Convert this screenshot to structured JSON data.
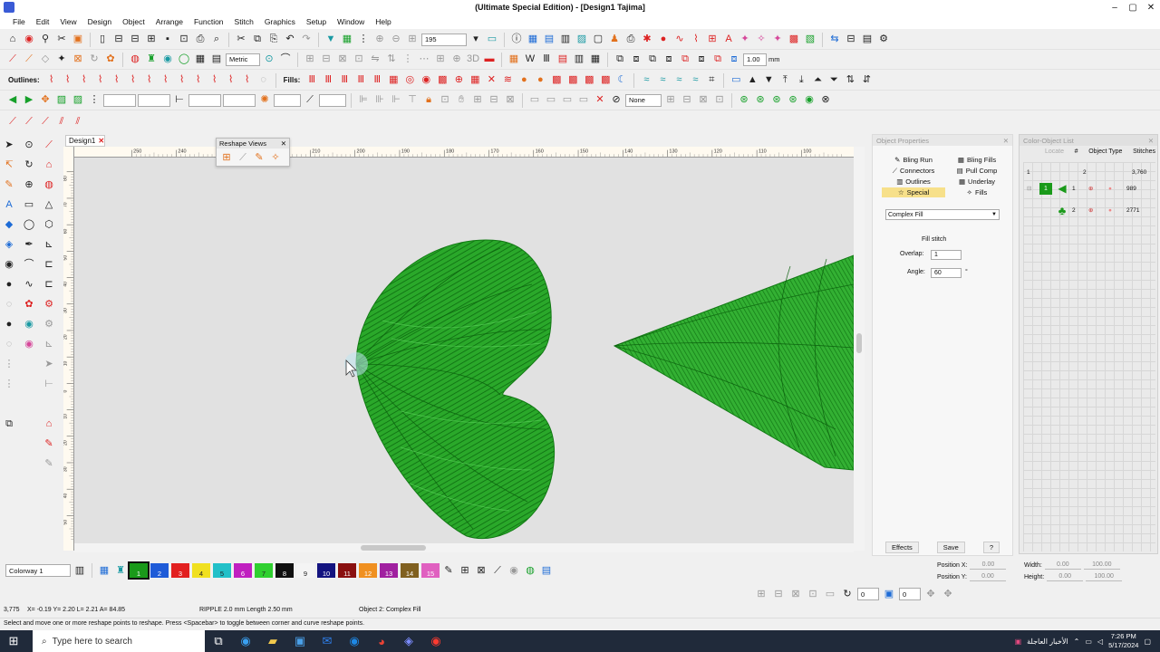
{
  "window": {
    "title": "(Ultimate Special Edition) - [Design1     Tajima]",
    "controls": [
      "–",
      "▢",
      "✕"
    ]
  },
  "menu": [
    "File",
    "Edit",
    "View",
    "Design",
    "Object",
    "Arrange",
    "Function",
    "Stitch",
    "Graphics",
    "Setup",
    "Window",
    "Help"
  ],
  "toolbar1": {
    "zoom_value": "195",
    "icons_left": [
      "home-icon",
      "open-book-icon",
      "pin-icon",
      "needle-icon",
      "folder-icon",
      "new-icon",
      "open-icon",
      "open2-icon",
      "open3-icon",
      "save-icon",
      "print-icon",
      "print-preview-icon",
      "cut-icon",
      "copy-icon",
      "paste-icon",
      "undo-icon",
      "redo-icon",
      "stitch-player-icon",
      "stitch-view-icon",
      "stitch-icon",
      "zoom-icon",
      "zoom-box-icon",
      "pan-icon"
    ],
    "icons_right": [
      "info-icon",
      "grid-icon",
      "tile-icon",
      "page-icon",
      "frame-icon",
      "hoop-icon",
      "user-icon",
      "print2-icon",
      "red-dot-icon",
      "curve-icon",
      "path-icon",
      "text-icon",
      "shape-icon",
      "shape2-icon",
      "shape3-icon",
      "fill-icon",
      "crosshatch-icon",
      "transfer-icon",
      "export-icon",
      "trace-icon",
      "gear-icon"
    ]
  },
  "toolbar2": {
    "units_value": "Metric",
    "size_value": "1.00",
    "size_unit": "mm"
  },
  "toolbar3": {
    "outlines_label": "Outlines:",
    "fills_label": "Fills:"
  },
  "toolbar4": {
    "none_value": "None"
  },
  "document": {
    "tab_label": "Design1"
  },
  "rulers": {
    "h_ticks": [
      "250",
      "240",
      "230",
      "220",
      "210",
      "200",
      "190",
      "180",
      "170",
      "160",
      "150",
      "140",
      "130",
      "120",
      "110",
      "100"
    ],
    "v_ticks": [
      "80",
      "70",
      "60",
      "50",
      "40",
      "30",
      "20",
      "10",
      "0",
      "10",
      "20",
      "30",
      "40",
      "50"
    ]
  },
  "reshape_views": {
    "title": "Reshape Views"
  },
  "object_properties": {
    "title": "Object Properties",
    "tabs": [
      {
        "label": "Bling Run",
        "active": false
      },
      {
        "label": "Bling Fills",
        "active": false
      },
      {
        "label": "Connectors",
        "active": false
      },
      {
        "label": "Pull Comp",
        "active": false
      },
      {
        "label": "Outlines",
        "active": false
      },
      {
        "label": "Underlay",
        "active": false
      },
      {
        "label": "Special",
        "active": true
      },
      {
        "label": "Fills",
        "active": false
      }
    ],
    "fill_type": "Complex Fill",
    "section_label": "Fill stitch",
    "overlap_label": "Overlap:",
    "overlap_value": "1",
    "angle_label": "Angle:",
    "angle_value": "60",
    "angle_unit": "°",
    "effects_button": "Effects",
    "save_button": "Save",
    "help_button": "?"
  },
  "color_list": {
    "title": "Color-Object List",
    "locate": "Locate",
    "col_number": "#",
    "col_type": "Object Type",
    "col_stitches": "Stitches",
    "total_index": "1",
    "total_count": "2",
    "total_stitches": "3,760",
    "rows": [
      {
        "index": "1",
        "stitches": "989"
      },
      {
        "index": "2",
        "stitches": "2771"
      }
    ]
  },
  "colorbar": {
    "colorway": "Colorway 1",
    "swatches": [
      {
        "num": "1",
        "color": "#1a9a1a"
      },
      {
        "num": "2",
        "color": "#1e5bd8"
      },
      {
        "num": "3",
        "color": "#e22020"
      },
      {
        "num": "4",
        "color": "#f0e020"
      },
      {
        "num": "5",
        "color": "#22c0c8"
      },
      {
        "num": "6",
        "color": "#c020c0"
      },
      {
        "num": "7",
        "color": "#30d030"
      },
      {
        "num": "8",
        "color": "#101010"
      },
      {
        "num": "9",
        "color": "#f4f4f4"
      },
      {
        "num": "10",
        "color": "#141480"
      },
      {
        "num": "11",
        "color": "#8a1010"
      },
      {
        "num": "12",
        "color": "#f09020"
      },
      {
        "num": "13",
        "color": "#a020a0"
      },
      {
        "num": "14",
        "color": "#806020"
      },
      {
        "num": "15",
        "color": "#e060c0"
      }
    ]
  },
  "position": {
    "pos_x_label": "Position X:",
    "pos_x": "0.00",
    "pos_y_label": "Position Y:",
    "pos_y": "0.00",
    "width_label": "Width:",
    "width": "0.00",
    "height_label": "Height:",
    "height": "0.00",
    "scale_w": "100.00",
    "scale_h": "100.00"
  },
  "zoombar": {
    "val1": "0",
    "val2": "0"
  },
  "status": {
    "stitch_count": "3,775",
    "coords": "X= -0.19 Y= 2.20 L= 2.21 A= 84.85",
    "stitch_info": "RIPPLE 2.0 mm Length  2.50 mm",
    "object_info": "Object 2: Complex Fill",
    "hint": "Select and move one or more reshape points to reshape. Press <Spacebar> to toggle between corner and curve reshape points."
  },
  "taskbar": {
    "search_placeholder": "Type here to search",
    "news": "الأخبار العاجلة",
    "time": "7:26 PM",
    "date": "5/17/2024"
  },
  "colors": {
    "stitch_green": "#22a322",
    "stitch_dark": "#0f6e12",
    "canvas": "#e1e1e1",
    "active_tab": "#f7e08a"
  }
}
